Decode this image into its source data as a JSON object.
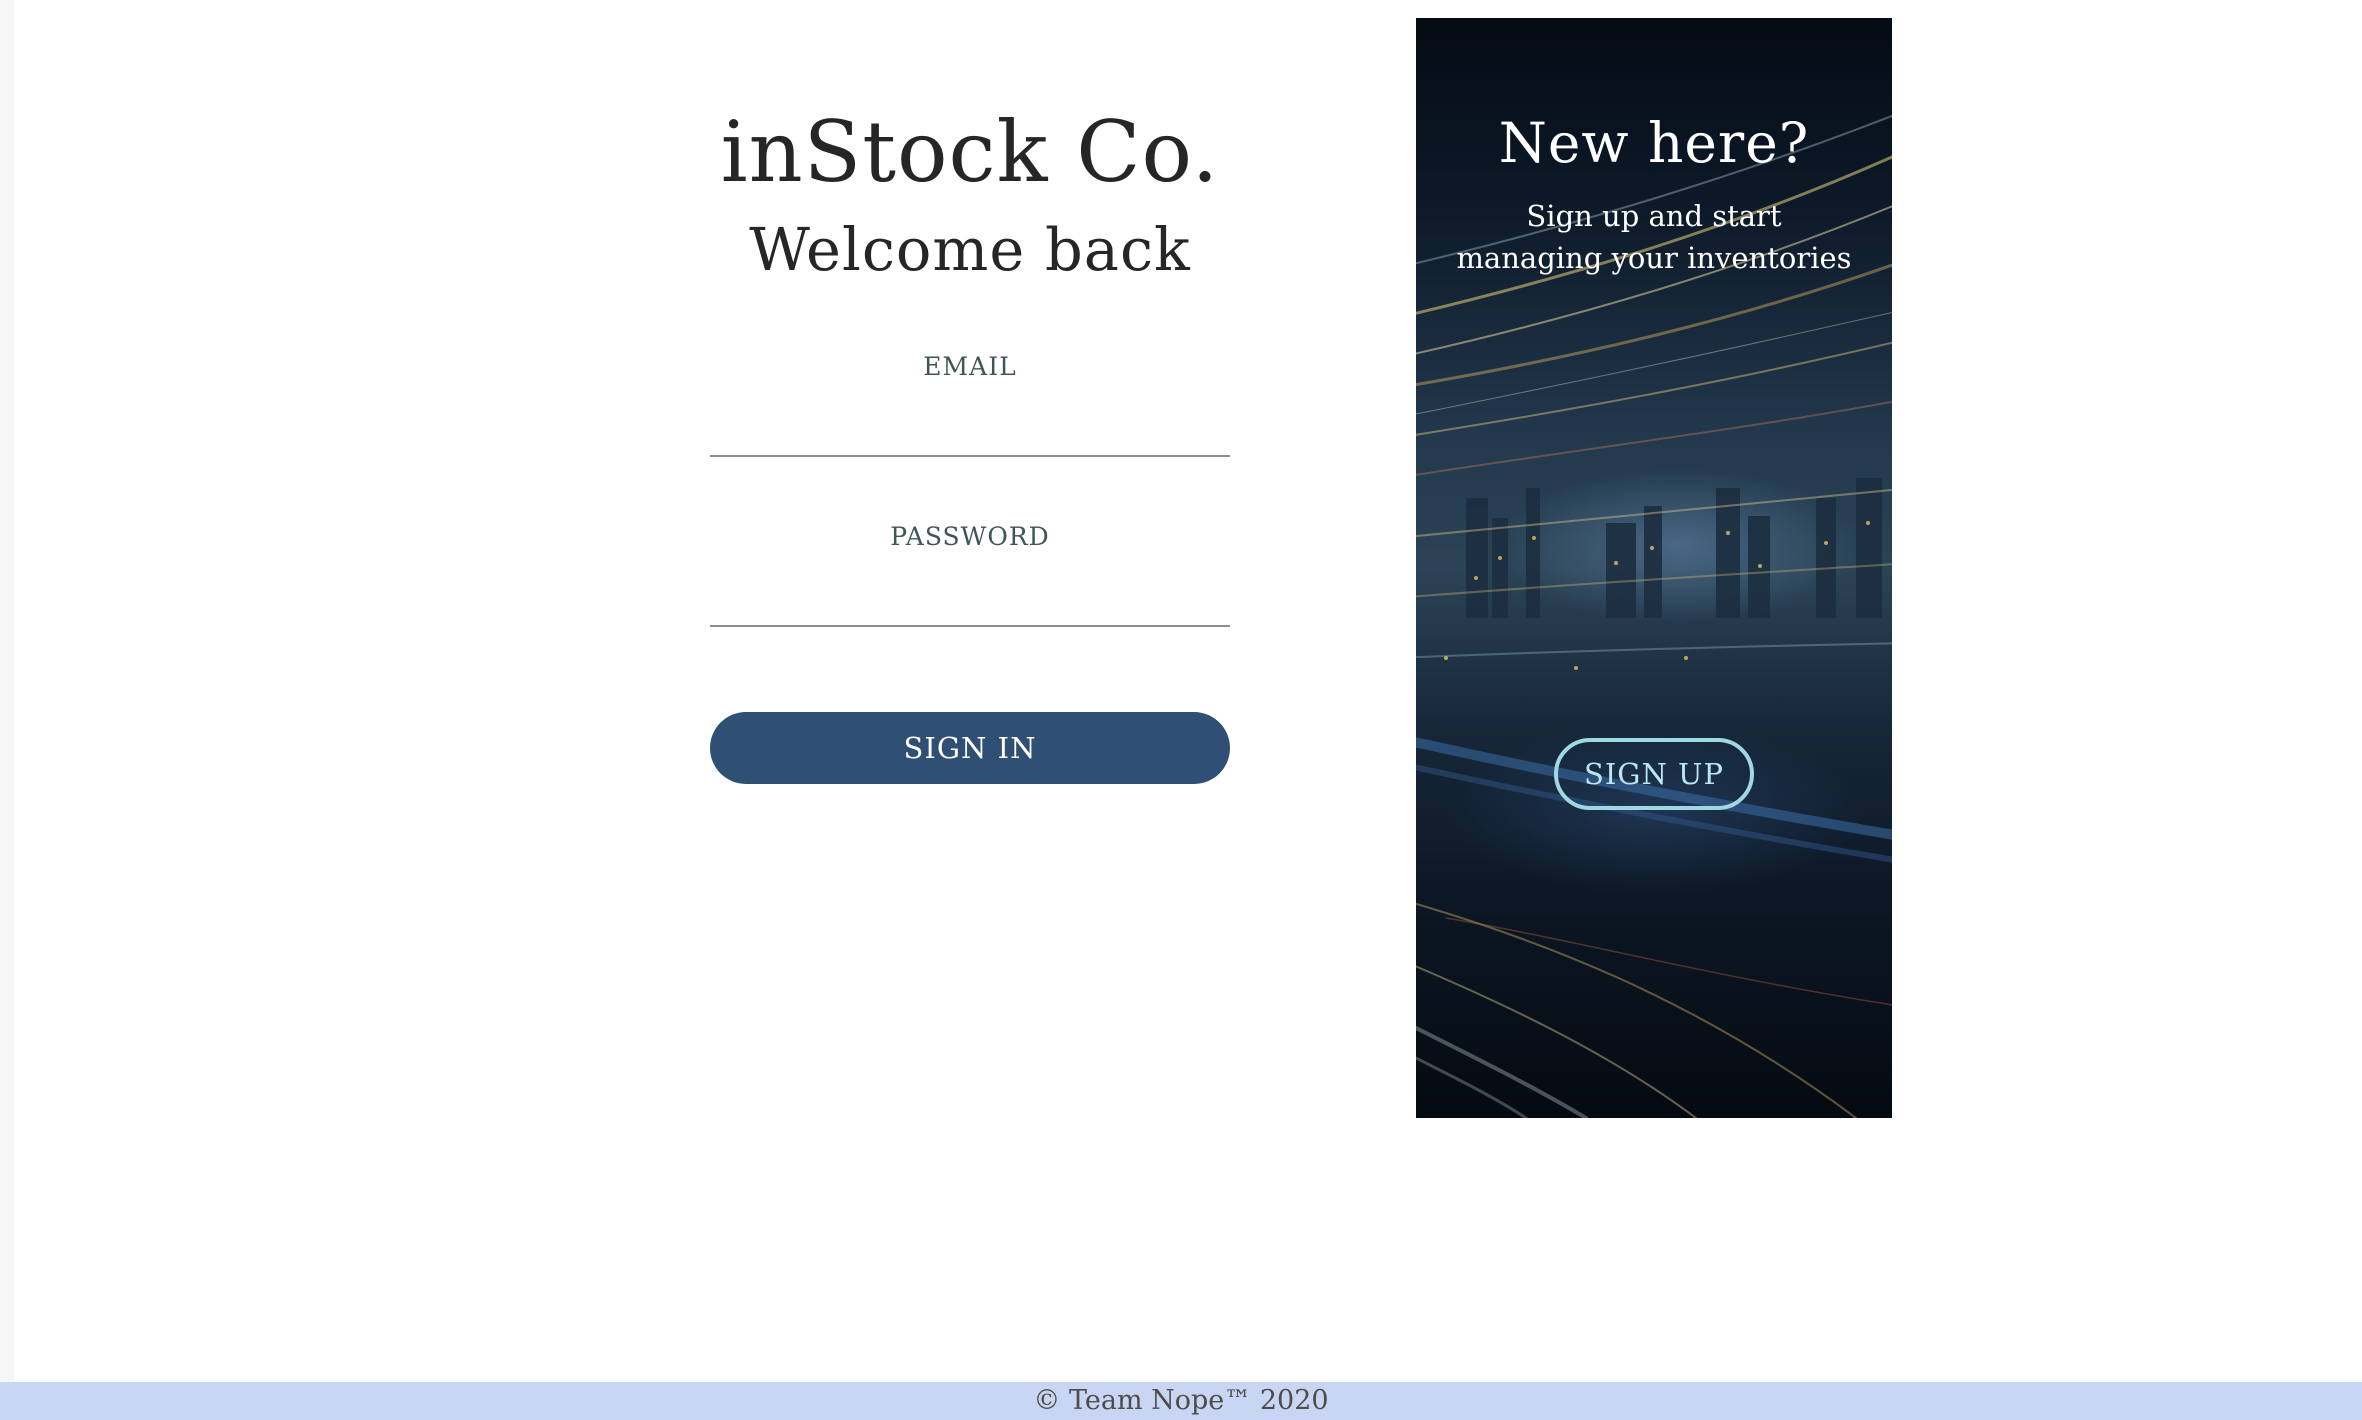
{
  "signin": {
    "brand": "inStock Co.",
    "subtitle": "Welcome back",
    "email_label": "EMAIL",
    "email_value": "",
    "password_label": "PASSWORD",
    "password_value": "",
    "submit_label": "SIGN IN",
    "button_color": "#304f74"
  },
  "signup": {
    "title": "New here?",
    "text": "Sign up and start managing your inventories",
    "button_label": "SIGN UP",
    "button_border_color": "#9fd8e3",
    "background": "night city light-trails photo"
  },
  "footer": {
    "text": "© Team Nope™ 2020",
    "background": "#c9d6f3"
  }
}
